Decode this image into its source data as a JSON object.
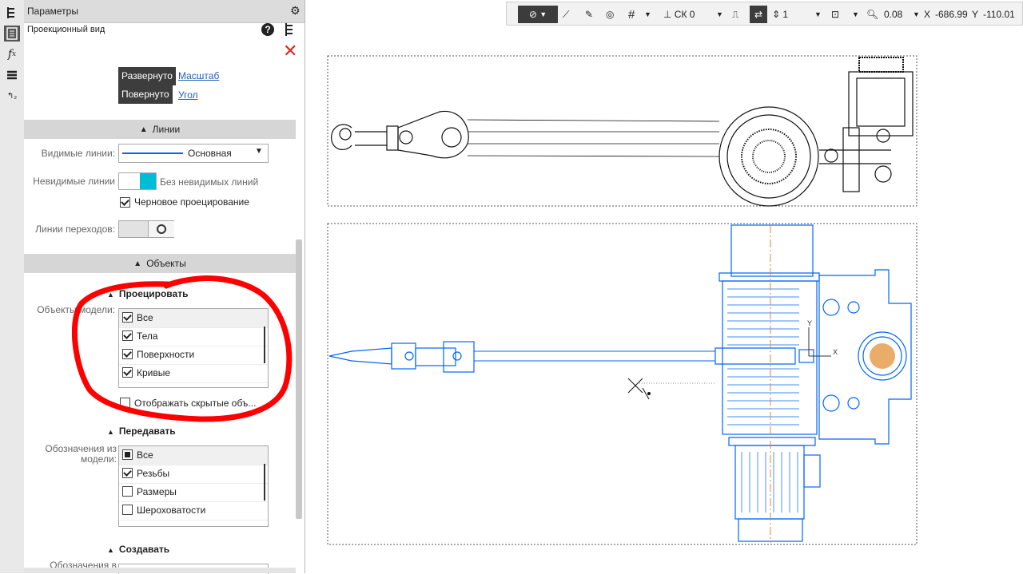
{
  "left_strip": {
    "icons": [
      "tree-icon",
      "table-icon",
      "fx-icon",
      "layers-icon",
      "order-icon"
    ]
  },
  "panel": {
    "title": "Параметры",
    "subtitle": "Проекционный вид",
    "view": {
      "expanded_tag": "Развернуто",
      "expanded_link": "Масштаб",
      "rotated_tag": "Повернуто",
      "rotated_link": "Угол"
    },
    "lines": {
      "header": "Линии",
      "visible_label": "Видимые линии:",
      "visible_value": "Основная",
      "hidden_label": "Невидимые линии",
      "hidden_value": "Без невидимых линий",
      "draft_label": "Черновое проецирование",
      "draft_checked": true,
      "transition_label": "Линии переходов:"
    },
    "objects": {
      "header": "Объекты",
      "project": {
        "header": "Проецировать",
        "label": "Объекты модели:",
        "items": [
          {
            "label": "Все",
            "state": "checked"
          },
          {
            "label": "Тела",
            "state": "checked"
          },
          {
            "label": "Поверхности",
            "state": "checked"
          },
          {
            "label": "Кривые",
            "state": "checked"
          }
        ],
        "show_hidden": "Отображать скрытые объ..."
      },
      "transfer": {
        "header": "Передавать",
        "label_line1": "Обозначения из",
        "label_line2": "модели:",
        "items": [
          {
            "label": "Все",
            "state": "partial"
          },
          {
            "label": "Резьбы",
            "state": "checked"
          },
          {
            "label": "Размеры",
            "state": "unchecked"
          },
          {
            "label": "Шероховатости",
            "state": "unchecked"
          }
        ]
      },
      "create": {
        "header": "Создавать",
        "label": "Обозначения в"
      }
    }
  },
  "toolbar": {
    "cs": "СК 0",
    "layer": "1",
    "zoom": "0.08",
    "x_label": "X",
    "x_value": "-686.99",
    "y_label": "Y",
    "y_value": "-110.01"
  },
  "drawing": {
    "x_axis": "X",
    "y_axis": "Y"
  },
  "colors": {
    "accent": "#0066ff",
    "highlight": "#ff0000",
    "cyan": "#00bcd4",
    "orange": "#e08a2a"
  }
}
